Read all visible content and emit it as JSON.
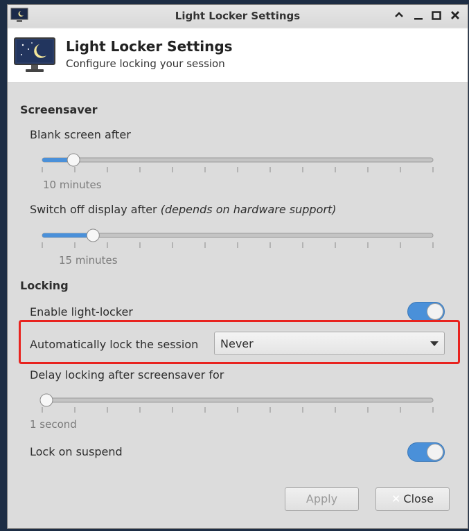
{
  "window": {
    "title": "Light Locker Settings"
  },
  "header": {
    "title": "Light Locker Settings",
    "subtitle": "Configure locking your session"
  },
  "screensaver": {
    "section_title": "Screensaver",
    "blank_label": "Blank screen after",
    "blank_value": "10 minutes",
    "blank_fraction": 0.08,
    "switch_off_label": "Switch off display after",
    "switch_off_note": "(depends on hardware support)",
    "switch_off_value": "15 minutes",
    "switch_off_fraction": 0.13
  },
  "locking": {
    "section_title": "Locking",
    "enable_label": "Enable light-locker",
    "enable_on": true,
    "auto_lock_label": "Automatically lock the session",
    "auto_lock_value": "Never",
    "delay_label": "Delay locking after screensaver for",
    "delay_value": "1 second",
    "delay_fraction": 0.0,
    "suspend_label": "Lock on suspend",
    "suspend_on": true
  },
  "buttons": {
    "apply": "Apply",
    "close": "Close"
  },
  "colors": {
    "accent": "#4a90d9",
    "highlight": "#e8231f"
  }
}
